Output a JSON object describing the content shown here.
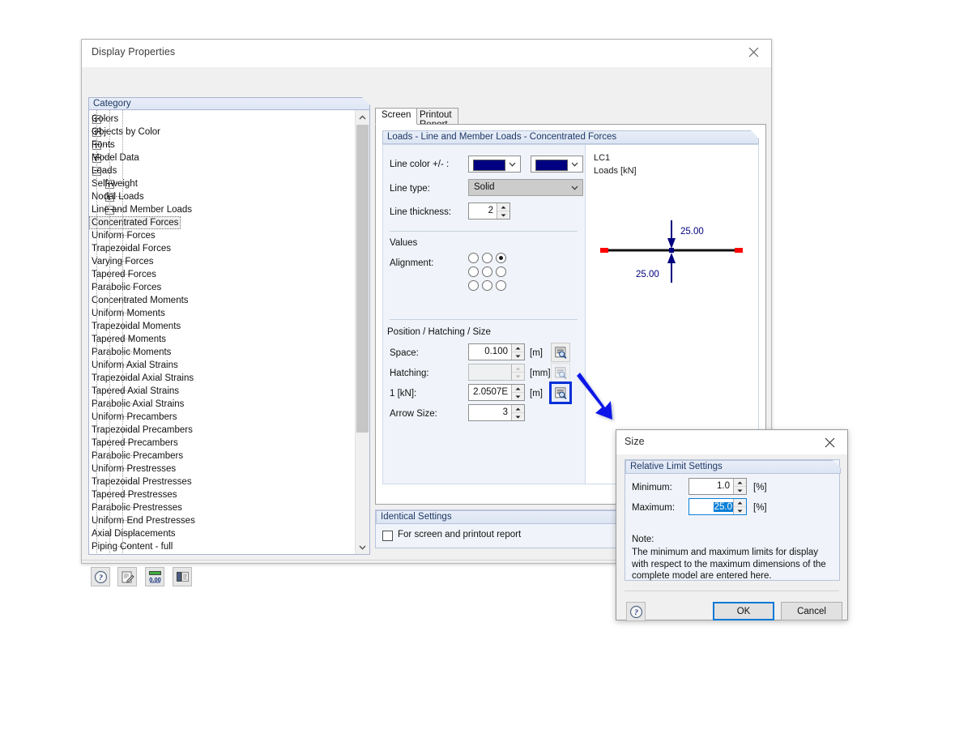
{
  "window": {
    "title": "Display Properties",
    "close_icon": "close-icon"
  },
  "category_panel": {
    "header": "Category",
    "items": [
      {
        "label": "Colors",
        "depth": 0,
        "toggle": "plus"
      },
      {
        "label": "Objects by Color",
        "depth": 0,
        "toggle": "plus"
      },
      {
        "label": "Fonts",
        "depth": 0,
        "toggle": "plus"
      },
      {
        "label": "Model Data",
        "depth": 0,
        "toggle": "plus"
      },
      {
        "label": "Loads",
        "depth": 0,
        "toggle": "minus"
      },
      {
        "label": "Self-weight",
        "depth": 1,
        "toggle": "plus"
      },
      {
        "label": "Nodal Loads",
        "depth": 1,
        "toggle": "plus"
      },
      {
        "label": "Line and Member Loads",
        "depth": 1,
        "toggle": "minus"
      },
      {
        "label": "Concentrated Forces",
        "depth": 2,
        "toggle": "none",
        "selected": true
      },
      {
        "label": "Uniform Forces",
        "depth": 2,
        "toggle": "none"
      },
      {
        "label": "Trapezoidal Forces",
        "depth": 2,
        "toggle": "none"
      },
      {
        "label": "Varying Forces",
        "depth": 2,
        "toggle": "none"
      },
      {
        "label": "Tapered Forces",
        "depth": 2,
        "toggle": "none"
      },
      {
        "label": "Parabolic Forces",
        "depth": 2,
        "toggle": "none"
      },
      {
        "label": "Concentrated Moments",
        "depth": 2,
        "toggle": "none"
      },
      {
        "label": "Uniform Moments",
        "depth": 2,
        "toggle": "none"
      },
      {
        "label": "Trapezoidal Moments",
        "depth": 2,
        "toggle": "none"
      },
      {
        "label": "Tapered Moments",
        "depth": 2,
        "toggle": "none"
      },
      {
        "label": "Parabolic Moments",
        "depth": 2,
        "toggle": "none"
      },
      {
        "label": "Uniform Axial Strains",
        "depth": 2,
        "toggle": "none"
      },
      {
        "label": "Trapezoidal Axial Strains",
        "depth": 2,
        "toggle": "none"
      },
      {
        "label": "Tapered Axial Strains",
        "depth": 2,
        "toggle": "none"
      },
      {
        "label": "Parabolic Axial Strains",
        "depth": 2,
        "toggle": "none"
      },
      {
        "label": "Uniform Precambers",
        "depth": 2,
        "toggle": "none"
      },
      {
        "label": "Trapezoidal Precambers",
        "depth": 2,
        "toggle": "none"
      },
      {
        "label": "Tapered Precambers",
        "depth": 2,
        "toggle": "none"
      },
      {
        "label": "Parabolic Precambers",
        "depth": 2,
        "toggle": "none"
      },
      {
        "label": "Uniform Prestresses",
        "depth": 2,
        "toggle": "none"
      },
      {
        "label": "Trapezoidal Prestresses",
        "depth": 2,
        "toggle": "none"
      },
      {
        "label": "Tapered Prestresses",
        "depth": 2,
        "toggle": "none"
      },
      {
        "label": "Parabolic Prestresses",
        "depth": 2,
        "toggle": "none"
      },
      {
        "label": "Uniform End Prestresses",
        "depth": 2,
        "toggle": "none"
      },
      {
        "label": "Axial Displacements",
        "depth": 2,
        "toggle": "none"
      },
      {
        "label": "Piping Content - full",
        "depth": 2,
        "toggle": "none"
      }
    ],
    "scroll_up_icon": "chevron-up-icon",
    "scroll_down_icon": "chevron-down-icon"
  },
  "tabs": [
    {
      "id": "screen",
      "label": "Screen",
      "active": true
    },
    {
      "id": "printout",
      "label": "Printout Report",
      "active": false
    }
  ],
  "screen_tab": {
    "section_header": "Loads - Line and Member Loads - Concentrated Forces",
    "line_color_label": "Line color +/- :",
    "line_color_plus": "#000080",
    "line_color_minus": "#000080",
    "line_type_label": "Line type:",
    "line_type_value": "Solid",
    "line_thickness_label": "Line thickness:",
    "line_thickness_value": "2",
    "values_label": "Values",
    "alignment_label": "Alignment:",
    "alignment_selected_index": 2,
    "position_header": "Position / Hatching / Size",
    "rows": [
      {
        "label": "Space:",
        "value": "0.100",
        "unit": "[m]",
        "disabled": false,
        "mag": "enabled"
      },
      {
        "label": "Hatching:",
        "value": "",
        "unit": "[mm]",
        "disabled": true,
        "mag": "disabled"
      },
      {
        "label": "1  [kN]:",
        "value": "2.0507E",
        "unit": "[m]",
        "disabled": false,
        "mag": "focused"
      },
      {
        "label": "Arrow Size:",
        "value": "3",
        "unit": "",
        "disabled": false,
        "mag": "none"
      }
    ],
    "magnify_icon": "magnify-icon"
  },
  "preview": {
    "load_case": "LC1",
    "units_label": "Loads [kN]",
    "top_value": "25.00",
    "bottom_value": "25.00",
    "arrow_color": "#000080",
    "member_end_color": "#ff0000"
  },
  "identical_settings": {
    "header": "Identical Settings",
    "checkbox_label": "For screen and printout report",
    "checked": false
  },
  "footer_toolbar": [
    {
      "name": "help-icon",
      "glyph": "?"
    },
    {
      "name": "edit-icon",
      "glyph": "pencil"
    },
    {
      "name": "number-format-icon",
      "glyph": "0.00"
    },
    {
      "name": "panel-settings-icon",
      "glyph": "panel"
    }
  ],
  "size_dialog": {
    "title": "Size",
    "close_icon": "close-icon",
    "group_header": "Relative Limit Settings",
    "minimum_label": "Minimum:",
    "minimum_value": "1.0",
    "minimum_unit": "[%]",
    "maximum_label": "Maximum:",
    "maximum_value": "25.0",
    "maximum_unit": "[%]",
    "maximum_selected": true,
    "note_label": "Note:",
    "note_text": "The minimum and maximum limits for display with respect to the maximum dimensions of the complete model are entered here.",
    "help_icon": "help-icon",
    "ok_label": "OK",
    "cancel_label": "Cancel"
  },
  "annotation": {
    "arrow_color": "#0a18e8",
    "name": "blue-pointer-arrow"
  }
}
